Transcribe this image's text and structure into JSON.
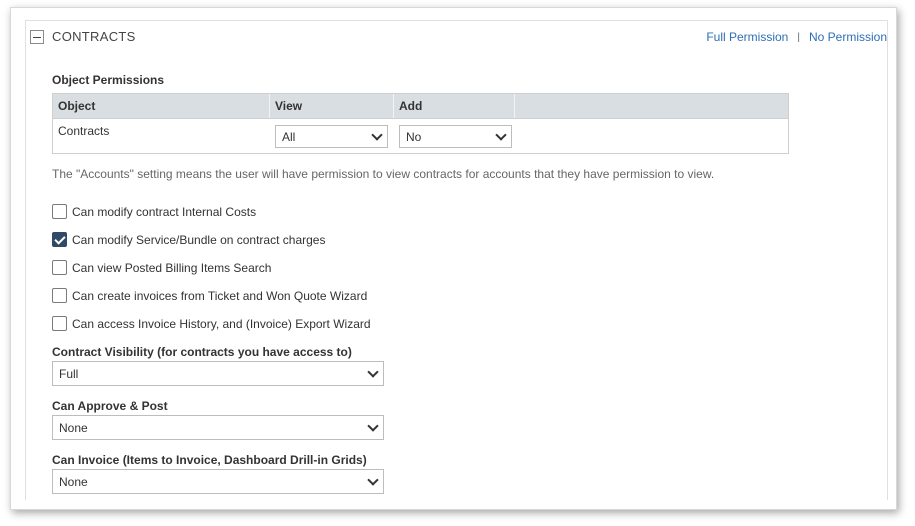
{
  "section": {
    "title": "CONTRACTS",
    "full_permission": "Full Permission",
    "separator": "|",
    "no_permission": "No Permission"
  },
  "object_permissions": {
    "title": "Object Permissions",
    "columns": [
      "Object",
      "View",
      "Add",
      ""
    ],
    "rows": [
      {
        "object": "Contracts",
        "view": "All",
        "add": "No"
      }
    ]
  },
  "note": "The \"Accounts\" setting means the user will have permission to view contracts for accounts that they have permission to view.",
  "checkboxes": [
    {
      "label": "Can modify contract Internal Costs",
      "checked": false
    },
    {
      "label": "Can modify Service/Bundle on contract charges",
      "checked": true
    },
    {
      "label": "Can view Posted Billing Items Search",
      "checked": false
    },
    {
      "label": "Can create invoices from Ticket and Won Quote Wizard",
      "checked": false
    },
    {
      "label": "Can access Invoice History, and (Invoice) Export Wizard",
      "checked": false
    }
  ],
  "fields": [
    {
      "label": "Contract Visibility (for contracts you have access to)",
      "value": "Full"
    },
    {
      "label": "Can Approve & Post",
      "value": "None"
    },
    {
      "label": "Can Invoice (Items to Invoice, Dashboard Drill-in Grids)",
      "value": "None"
    }
  ],
  "colors": {
    "link": "#2e6eb5",
    "table_header": "#d9dee3",
    "checkbox_checked": "#2f4a66"
  }
}
